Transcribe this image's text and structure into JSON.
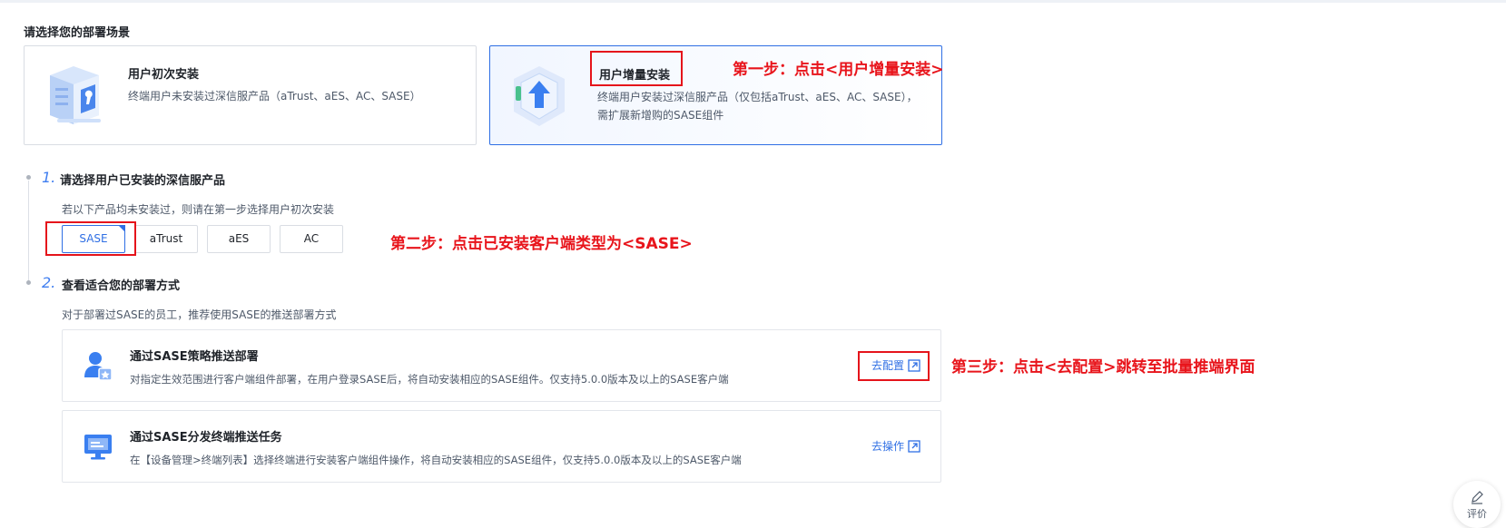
{
  "scene": {
    "title": "请选择您的部署场景",
    "cards": [
      {
        "title": "用户初次安装",
        "desc": "终端用户未安装过深信服产品（aTrust、aES、AC、SASE）",
        "icon": "server-wrench-icon"
      },
      {
        "title": "用户增量安装",
        "desc_line1": "终端用户安装过深信服产品（仅包括aTrust、aES、AC、SASE），",
        "desc_line2": "需扩展新增购的SASE组件",
        "icon": "upgrade-arrow-icon"
      }
    ],
    "selected": "用户增量安装"
  },
  "step1": {
    "num": "1.",
    "title": "请选择用户已安装的深信服产品",
    "hint": "若以下产品均未安装过，则请在第一步选择用户初次安装",
    "products": [
      "SASE",
      "aTrust",
      "aES",
      "AC"
    ],
    "selected": "SASE"
  },
  "step2": {
    "num": "2.",
    "title": "查看适合您的部署方式",
    "hint": "对于部署过SASE的员工，推荐使用SASE的推送部署方式",
    "methods": [
      {
        "title": "通过SASE策略推送部署",
        "desc": "对指定生效范围进行客户端组件部署，在用户登录SASE后，将自动安装相应的SASE组件。仅支持5.0.0版本及以上的SASE客户端",
        "link": "去配置",
        "icon": "user-star-icon"
      },
      {
        "title": "通过SASE分发终端推送任务",
        "desc": "在【设备管理>终端列表】选择终端进行安装客户端组件操作，将自动安装相应的SASE组件，仅支持5.0.0版本及以上的SASE客户端",
        "link": "去操作",
        "icon": "monitor-icon"
      }
    ]
  },
  "annotations": {
    "step_one": "第一步：点击<用户增量安装>",
    "step_two": "第二步：点击已安装客户端类型为<SASE>",
    "step_three": "第三步：点击<去配置>跳转至批量推端界面"
  },
  "feedback": {
    "label": "评价",
    "icon": "pen-icon"
  },
  "colors": {
    "accent": "#2f6fe4",
    "annotation": "#e5141b"
  }
}
